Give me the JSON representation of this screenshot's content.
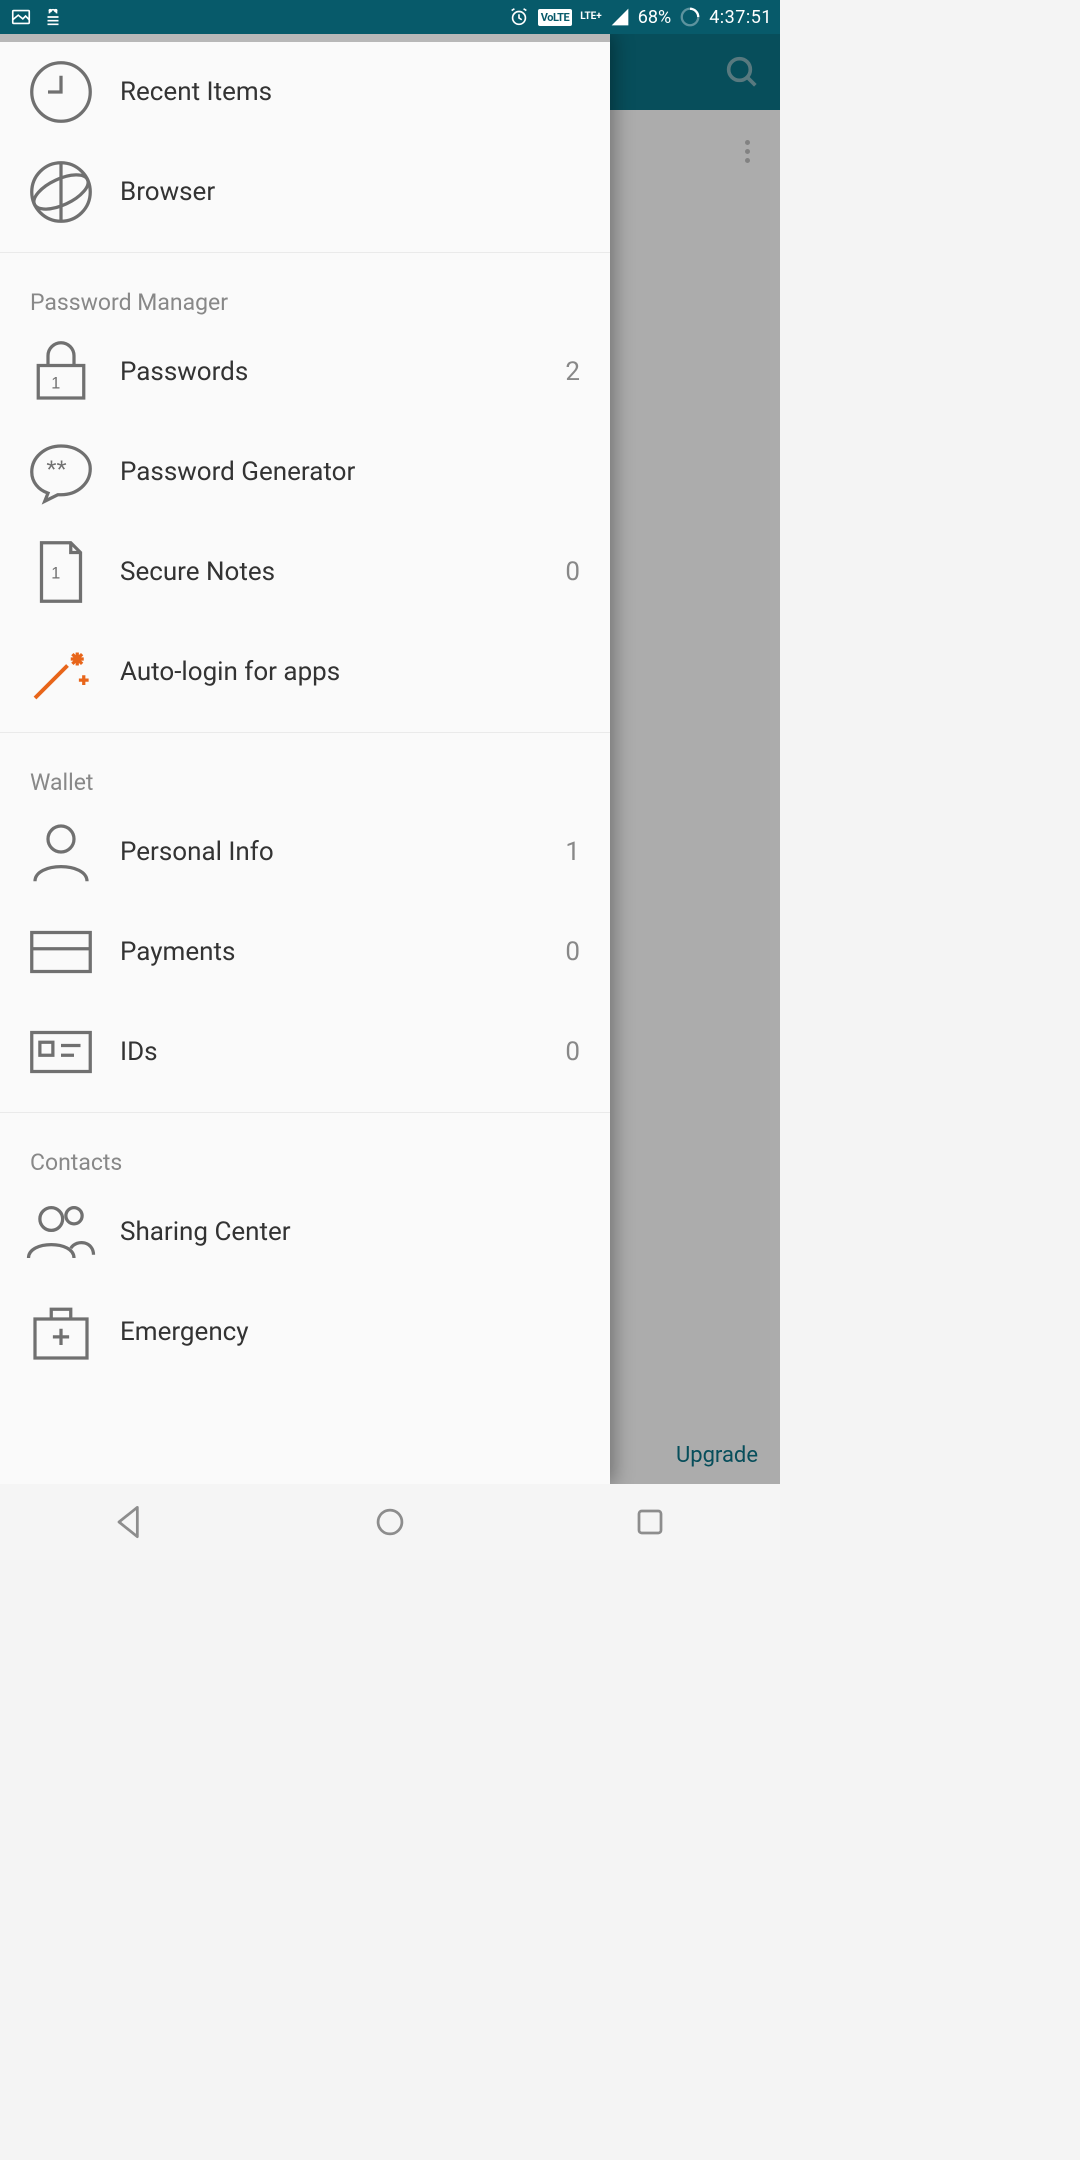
{
  "status": {
    "battery": "68%",
    "time": "4:37:51",
    "volte": "VoLTE",
    "lte": "LTE+"
  },
  "background": {
    "upgrade_label": "Upgrade"
  },
  "drawer": {
    "sections": [
      {
        "header": "",
        "items": [
          {
            "icon": "clock",
            "label": "Recent Items",
            "count": ""
          },
          {
            "icon": "globe",
            "label": "Browser",
            "count": ""
          }
        ]
      },
      {
        "header": "Password Manager",
        "items": [
          {
            "icon": "lock",
            "label": "Passwords",
            "count": "2"
          },
          {
            "icon": "bubble",
            "label": "Password Generator",
            "count": ""
          },
          {
            "icon": "note",
            "label": "Secure Notes",
            "count": "0"
          },
          {
            "icon": "wand",
            "label": "Auto-login for apps",
            "count": "",
            "highlight": true
          }
        ]
      },
      {
        "header": "Wallet",
        "items": [
          {
            "icon": "person",
            "label": "Personal Info",
            "count": "1"
          },
          {
            "icon": "card",
            "label": "Payments",
            "count": "0"
          },
          {
            "icon": "id",
            "label": "IDs",
            "count": "0"
          }
        ]
      },
      {
        "header": "Contacts",
        "items": [
          {
            "icon": "people",
            "label": "Sharing Center",
            "count": ""
          },
          {
            "icon": "case",
            "label": "Emergency",
            "count": ""
          }
        ]
      }
    ]
  }
}
